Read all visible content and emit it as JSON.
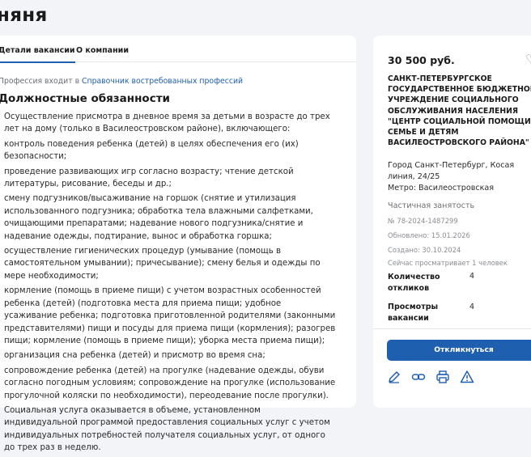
{
  "page": {
    "title": " няня"
  },
  "tabs": [
    {
      "label": "Детали вакансии",
      "active": true
    },
    {
      "label": "О компании",
      "active": false
    }
  ],
  "profession": {
    "prefix": "Профессия входит в ",
    "link_text": "Справочник востребованных профессий"
  },
  "duties": {
    "title": "Должностные обязанности",
    "paragraphs": [
      "Осуществление присмотра в дневное время за детьми в возрасте до трех лет на дому (только в Василеостровском районе), включающего:",
      "контроль поведения ребенка (детей) в целях обеспечения его (их) безопасности;",
      "проведение развивающих игр согласно возрасту; чтение детской литературы, рисование, беседы и др.;",
      "смену подгузников/высаживание на горшок (снятие и утилизация использованного подгузника; обработка тела влажными салфетками, очищающими препаратами; надевание нового подгузника/снятие и надевание одежды, подтирание, вынос и обработка горшка;",
      "осуществление гигиенических процедур (умывание (помощь в самостоятельном умывании); причесывание); смену белья и одежды по мере необходимости;",
      "кормление (помощь в приеме пищи) с учетом возрастных особенностей ребенка (детей) (подготовка места для приема пищи; удобное усаживание ребенка; подготовка приготовленной родителями (законными представителями) пищи и посуды для приема пищи (кормления); разогрев пищи; кормление (помощь в приеме пищи); уборка места приема пищи);",
      "организация сна ребенка (детей) и присмотр во время сна;",
      "сопровождение ребенка (детей) на прогулке (надевание одежды, обуви согласно погодным условиям; сопровождение на прогулке (использование прогулочной коляски по необходимости), переодевание после прогулки).",
      "Социальная услуга оказывается в объеме, установленном индивидуальной программой предоставления социальных услуг с учетом индивидуальных потребностей получателя социальных услуг, от одного до трех раз в неделю."
    ]
  },
  "sidebar": {
    "salary": "30 500 руб.",
    "organization": "САНКТ-ПЕТЕРБУРГСКОЕ ГОСУДАРСТВЕННОЕ БЮДЖЕТНОЕ УЧРЕЖДЕНИЕ СОЦИАЛЬНОГО ОБСЛУЖИВАНИЯ НАСЕЛЕНИЯ \"ЦЕНТР СОЦИАЛЬНОЙ ПОМОЩИ СЕМЬЕ И ДЕТЯМ ВАСИЛЕОСТРОВСКОГО РАЙОНА\"",
    "address": "Город Санкт-Петербург, Косая линия, 24/25",
    "metro": "Метро: Василеостровская",
    "employment": "Частичная занятость",
    "number": "№ 78-2024-1487299",
    "updated": "Обновлено: 15.01.2026",
    "created": "Создано: 30.10.2024",
    "viewing": "Сейчас просматривает 1 человек",
    "responses_label": "Количество откликов",
    "responses_value": "4",
    "views_label": "Просмотры вакансии",
    "views_value": "4",
    "respond_button": "Откликнуться",
    "icons": [
      "pencil-icon",
      "link-icon",
      "printer-icon",
      "warning-icon",
      "heart-icon"
    ]
  },
  "colors": {
    "accent": "#1f5fb0",
    "background": "#f2f4f7",
    "muted": "#8a8d92"
  }
}
